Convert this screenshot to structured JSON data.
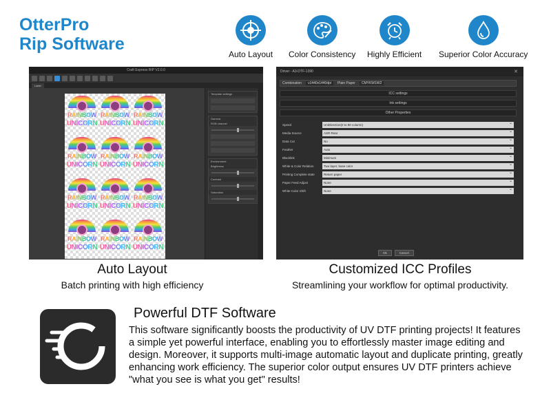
{
  "brand": {
    "line1": "OtterPro",
    "line2": "Rip Software",
    "color": "#1f87c9"
  },
  "features": [
    {
      "label": "Auto Layout",
      "icon": "crosshair-icon"
    },
    {
      "label": "Color Consistency",
      "icon": "palette-icon"
    },
    {
      "label": "Highly Efficient",
      "icon": "alarm-clock-icon"
    },
    {
      "label": "Superior Color Accuracy",
      "icon": "droplet-icon"
    }
  ],
  "screenshot_left": {
    "title": "Craft Express RIP V2.0.0",
    "tab": "Label",
    "tile_word1": "RAINBOW",
    "tile_word2": "UNICORN",
    "panels": [
      "Template settings",
      "Gamma",
      "Environment"
    ],
    "gamma_option": "RGB channel",
    "sliders": [
      "Brightness",
      "Contrast",
      "Saturation"
    ]
  },
  "screenshot_right": {
    "title": "Driver - A3-DTF-1390",
    "combination_label": "Combination",
    "combination_value": "v1440x1440dpi",
    "paper_label": "Plain Paper",
    "paper_value": "CMYKW1W2",
    "sections": [
      "ICC settings",
      "Ink settings",
      "Other Properties"
    ],
    "rows": [
      {
        "key": "Speed",
        "value": "UniDirection(0 to 80 column)"
      },
      {
        "key": "Media Source",
        "value": "ASR Rear"
      },
      {
        "key": "Data Cut",
        "value": "No"
      },
      {
        "key": "Feather",
        "value": "Auto"
      },
      {
        "key": "Blacklink",
        "value": "Minimum"
      },
      {
        "key": "White & Color Relation",
        "value": "Two layer, base color"
      },
      {
        "key": "Printing Complete state",
        "value": "Return paper"
      },
      {
        "key": "Paper Feed Adjust",
        "value": "None"
      },
      {
        "key": "White Color Shift",
        "value": "None"
      }
    ],
    "ok": "Ok",
    "cancel": "Cancel"
  },
  "captions": [
    {
      "title": "Auto Layout",
      "sub": "Batch printing with high efficiency"
    },
    {
      "title": "Customized ICC Profiles",
      "sub": "Streamlining your workflow for optimal productivity."
    }
  ],
  "software": {
    "title": "Powerful DTF Software",
    "text": "This software significantly boosts the productivity of UV DTF printing projects! It features a simple yet powerful interface, enabling you to effortlessly master image editing and design. Moreover, it supports multi-image automatic layout and duplicate printing, greatly enhancing work efficiency. The superior color output ensures UV DTF printers achieve \"what you see is what you get\" results!"
  }
}
